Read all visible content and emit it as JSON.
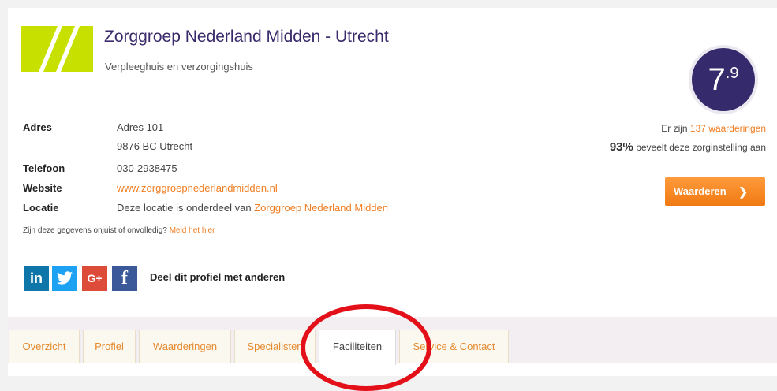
{
  "header": {
    "title": "Zorggroep Nederland Midden - Utrecht",
    "subtitle": "Verpleeghuis en verzorgingshuis",
    "score_main": "7",
    "score_decimal": ".9"
  },
  "details": {
    "address_label": "Adres",
    "address_line1": "Adres 101",
    "address_line2": "9876 BC Utrecht",
    "phone_label": "Telefoon",
    "phone": "030-2938475",
    "website_label": "Website",
    "website": "www.zorggroepnederlandmidden.nl",
    "location_label": "Locatie",
    "location_text": "Deze locatie is onderdeel van ",
    "location_link": "Zorggroep Nederland Midden",
    "report_text": "Zijn deze gegevens onjuist of onvolledig? ",
    "report_link": "Meld het hier"
  },
  "rating": {
    "count_prefix": "Er zijn ",
    "count_link": "137 waarderingen",
    "recommend_pct": "93%",
    "recommend_text": " beveelt deze zorginstelling aan",
    "button_label": "Waarderen",
    "button_chevron": "❯"
  },
  "share": {
    "linkedin": "in",
    "googleplus": "G+",
    "facebook": "f",
    "label": "Deel dit profiel met anderen"
  },
  "tabs": [
    {
      "label": "Overzicht"
    },
    {
      "label": "Profiel"
    },
    {
      "label": "Waarderingen"
    },
    {
      "label": "Specialisten"
    },
    {
      "label": "Faciliteiten"
    },
    {
      "label": "Service & Contact"
    }
  ],
  "colors": {
    "brand_purple": "#352a6b",
    "accent_orange": "#f07d22",
    "logo_green": "#c8e000",
    "annotation_red": "#e3101a",
    "linkedin_blue": "#0e76a8",
    "twitter_blue": "#1da1f2",
    "googleplus_red": "#dd4b39",
    "facebook_blue": "#3b5998"
  }
}
